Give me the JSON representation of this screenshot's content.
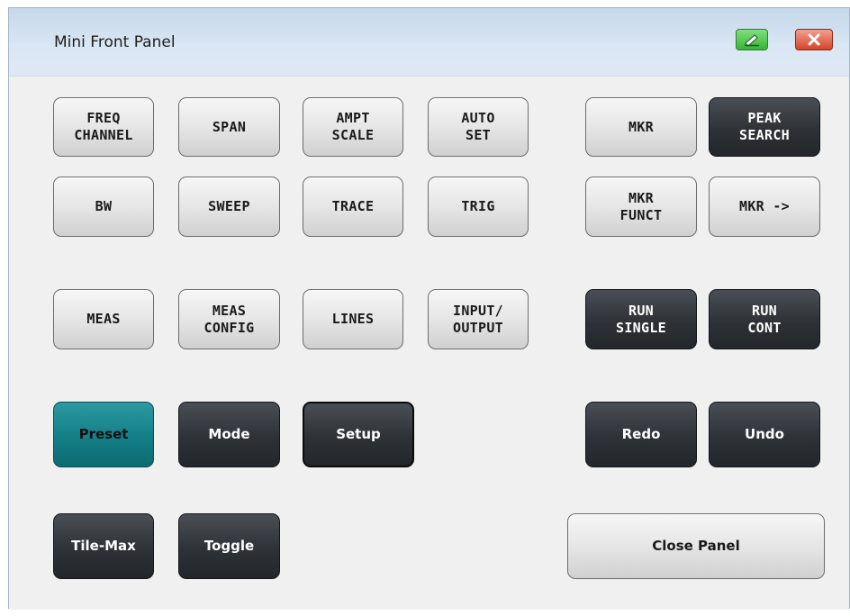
{
  "window": {
    "title": "Mini Front Panel",
    "icons": {
      "edit": "edit-icon",
      "close": "close-icon"
    }
  },
  "colors": {
    "light_button": "#e6e6e6",
    "dark_button": "#2e3237",
    "preset_button": "#127c84",
    "close_button": "#d4442a",
    "edit_button": "#37b437"
  },
  "buttons": {
    "freq_channel": "FREQ\nCHANNEL",
    "span": "SPAN",
    "ampt_scale": "AMPT\nSCALE",
    "auto_set": "AUTO\nSET",
    "mkr": "MKR",
    "peak_search": "PEAK\nSEARCH",
    "bw": "BW",
    "sweep": "SWEEP",
    "trace": "TRACE",
    "trig": "TRIG",
    "mkr_funct": "MKR\nFUNCT",
    "mkr_to": "MKR ->",
    "meas": "MEAS",
    "meas_config": "MEAS\nCONFIG",
    "lines": "LINES",
    "input_output": "INPUT/\nOUTPUT",
    "run_single": "RUN\nSINGLE",
    "run_cont": "RUN\nCONT",
    "preset": "Preset",
    "mode": "Mode",
    "setup": "Setup",
    "redo": "Redo",
    "undo": "Undo",
    "tile_max": "Tile-Max",
    "toggle": "Toggle",
    "close_panel": "Close Panel"
  }
}
